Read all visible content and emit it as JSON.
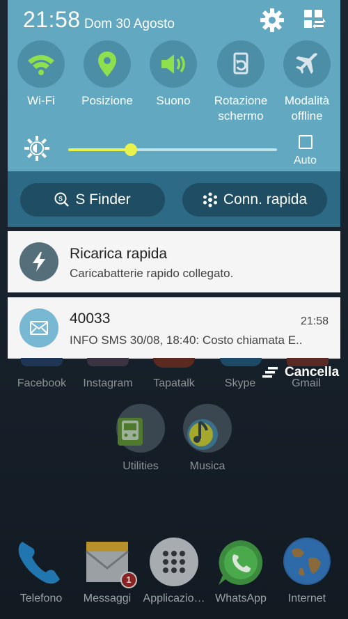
{
  "status": {
    "time": "21:58",
    "date": "Dom 30 Agosto"
  },
  "quick_settings": [
    {
      "label": "Wi-Fi",
      "icon": "wifi-icon",
      "active": true
    },
    {
      "label": "Posizione",
      "icon": "location-icon",
      "active": true
    },
    {
      "label": "Suono",
      "icon": "sound-icon",
      "active": true
    },
    {
      "label": "Rotazione\nschermo",
      "icon": "rotation-icon",
      "active": false
    },
    {
      "label": "Modalità\noffline",
      "icon": "airplane-icon",
      "active": false
    }
  ],
  "brightness": {
    "level": 0.3,
    "auto_label": "Auto",
    "auto_checked": false
  },
  "actions": {
    "s_finder": "S Finder",
    "quick_connect": "Conn. rapida"
  },
  "notifications": [
    {
      "title": "Ricarica rapida",
      "text": "Caricabatterie rapido collegato.",
      "time": "",
      "icon": "lightning-icon"
    },
    {
      "title": "40033",
      "text": "INFO SMS 30/08, 18:40: Costo chiamata E..",
      "time": "21:58",
      "icon": "mail-icon"
    }
  ],
  "clear_label": "Cancella",
  "home": {
    "row1": [
      "Facebook",
      "Instagram",
      "Tapatalk",
      "Skype",
      "Gmail"
    ],
    "row2": [
      "Utilities",
      "Musica"
    ],
    "dock": [
      "Telefono",
      "Messaggi",
      "Applicazio…",
      "WhatsApp",
      "Internet"
    ],
    "messages_badge": "1"
  },
  "colors": {
    "panel": "#62a8c1",
    "band": "#2d6a86",
    "accent_active": "#8ee04d",
    "slider": "#e8f24d"
  }
}
